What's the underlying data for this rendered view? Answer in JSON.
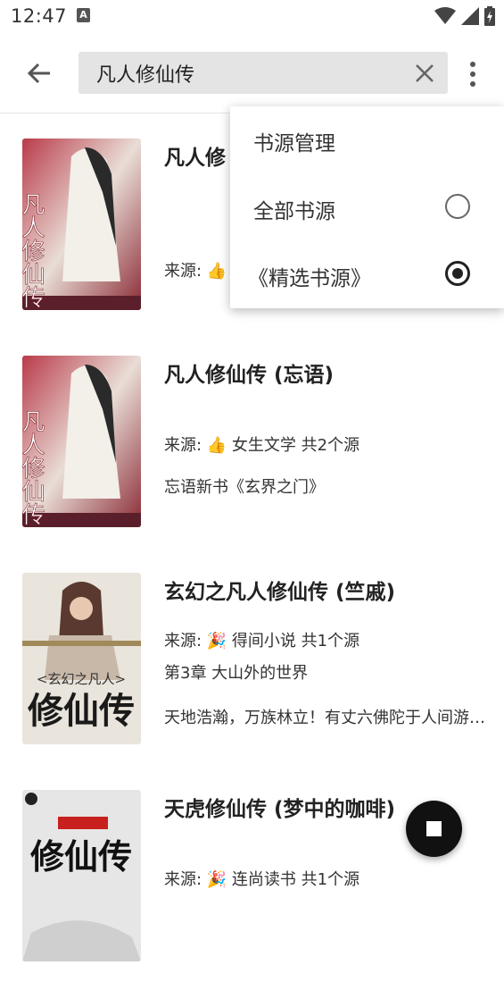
{
  "status_bar": {
    "time": "12:47",
    "notif_glyph": "A"
  },
  "search": {
    "value": "凡人修仙传",
    "placeholder": ""
  },
  "menu": {
    "items": [
      {
        "label": "书源管理",
        "radio": null
      },
      {
        "label": "全部书源",
        "radio": "off"
      },
      {
        "label": "《精选书源》",
        "radio": "on"
      }
    ]
  },
  "results": [
    {
      "title": "凡人修",
      "source": "来源: 👍",
      "cover_text": "凡人修仙传"
    },
    {
      "title": "凡人修仙传 (忘语)",
      "source": "来源: 👍 女生文学 共2个源",
      "extra": "忘语新书《玄界之门》",
      "cover_text": "凡人修仙传"
    },
    {
      "title": "玄幻之凡人修仙传 (竺戚)",
      "source": "来源: 🎉 得间小说 共1个源",
      "extra": "第3章 大山外的世界",
      "intro": "天地浩瀚，万族林立！有丈六佛陀于人间游走，有五爪金龙于...",
      "cover_text": "修仙传",
      "cover_subtitle": "<玄幻之凡人>"
    },
    {
      "title": "天虎修仙传 (梦中的咖啡)",
      "source": "来源: 🎉 连尚读书 共1个源",
      "cover_text": "修仙传"
    }
  ],
  "colors": {
    "accent": "#222222",
    "search_bg": "#e4e4e4",
    "menu_bg": "#ffffff"
  }
}
